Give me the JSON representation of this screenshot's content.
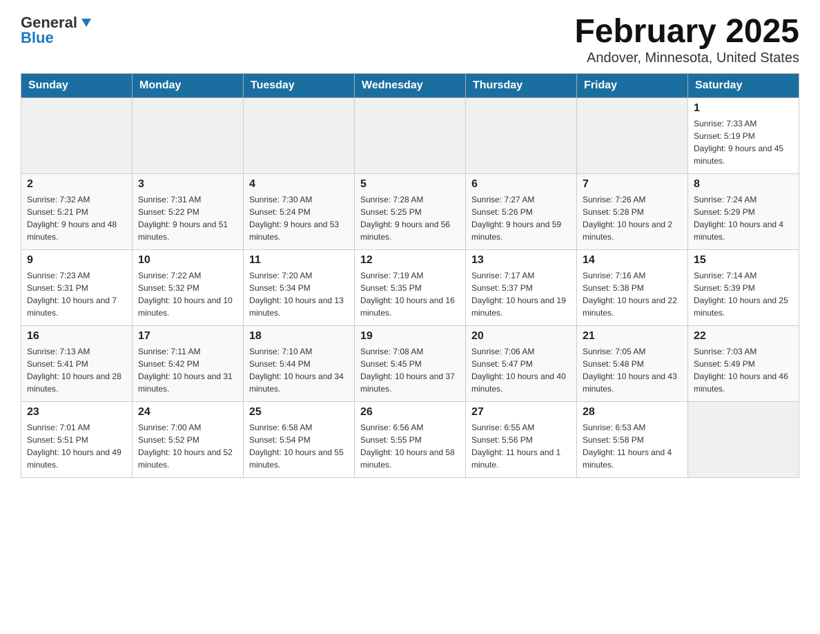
{
  "header": {
    "logo_general": "General",
    "logo_blue": "Blue",
    "title": "February 2025",
    "subtitle": "Andover, Minnesota, United States"
  },
  "days_of_week": [
    "Sunday",
    "Monday",
    "Tuesday",
    "Wednesday",
    "Thursday",
    "Friday",
    "Saturday"
  ],
  "weeks": [
    [
      {
        "day": "",
        "info": ""
      },
      {
        "day": "",
        "info": ""
      },
      {
        "day": "",
        "info": ""
      },
      {
        "day": "",
        "info": ""
      },
      {
        "day": "",
        "info": ""
      },
      {
        "day": "",
        "info": ""
      },
      {
        "day": "1",
        "info": "Sunrise: 7:33 AM\nSunset: 5:19 PM\nDaylight: 9 hours and 45 minutes."
      }
    ],
    [
      {
        "day": "2",
        "info": "Sunrise: 7:32 AM\nSunset: 5:21 PM\nDaylight: 9 hours and 48 minutes."
      },
      {
        "day": "3",
        "info": "Sunrise: 7:31 AM\nSunset: 5:22 PM\nDaylight: 9 hours and 51 minutes."
      },
      {
        "day": "4",
        "info": "Sunrise: 7:30 AM\nSunset: 5:24 PM\nDaylight: 9 hours and 53 minutes."
      },
      {
        "day": "5",
        "info": "Sunrise: 7:28 AM\nSunset: 5:25 PM\nDaylight: 9 hours and 56 minutes."
      },
      {
        "day": "6",
        "info": "Sunrise: 7:27 AM\nSunset: 5:26 PM\nDaylight: 9 hours and 59 minutes."
      },
      {
        "day": "7",
        "info": "Sunrise: 7:26 AM\nSunset: 5:28 PM\nDaylight: 10 hours and 2 minutes."
      },
      {
        "day": "8",
        "info": "Sunrise: 7:24 AM\nSunset: 5:29 PM\nDaylight: 10 hours and 4 minutes."
      }
    ],
    [
      {
        "day": "9",
        "info": "Sunrise: 7:23 AM\nSunset: 5:31 PM\nDaylight: 10 hours and 7 minutes."
      },
      {
        "day": "10",
        "info": "Sunrise: 7:22 AM\nSunset: 5:32 PM\nDaylight: 10 hours and 10 minutes."
      },
      {
        "day": "11",
        "info": "Sunrise: 7:20 AM\nSunset: 5:34 PM\nDaylight: 10 hours and 13 minutes."
      },
      {
        "day": "12",
        "info": "Sunrise: 7:19 AM\nSunset: 5:35 PM\nDaylight: 10 hours and 16 minutes."
      },
      {
        "day": "13",
        "info": "Sunrise: 7:17 AM\nSunset: 5:37 PM\nDaylight: 10 hours and 19 minutes."
      },
      {
        "day": "14",
        "info": "Sunrise: 7:16 AM\nSunset: 5:38 PM\nDaylight: 10 hours and 22 minutes."
      },
      {
        "day": "15",
        "info": "Sunrise: 7:14 AM\nSunset: 5:39 PM\nDaylight: 10 hours and 25 minutes."
      }
    ],
    [
      {
        "day": "16",
        "info": "Sunrise: 7:13 AM\nSunset: 5:41 PM\nDaylight: 10 hours and 28 minutes."
      },
      {
        "day": "17",
        "info": "Sunrise: 7:11 AM\nSunset: 5:42 PM\nDaylight: 10 hours and 31 minutes."
      },
      {
        "day": "18",
        "info": "Sunrise: 7:10 AM\nSunset: 5:44 PM\nDaylight: 10 hours and 34 minutes."
      },
      {
        "day": "19",
        "info": "Sunrise: 7:08 AM\nSunset: 5:45 PM\nDaylight: 10 hours and 37 minutes."
      },
      {
        "day": "20",
        "info": "Sunrise: 7:06 AM\nSunset: 5:47 PM\nDaylight: 10 hours and 40 minutes."
      },
      {
        "day": "21",
        "info": "Sunrise: 7:05 AM\nSunset: 5:48 PM\nDaylight: 10 hours and 43 minutes."
      },
      {
        "day": "22",
        "info": "Sunrise: 7:03 AM\nSunset: 5:49 PM\nDaylight: 10 hours and 46 minutes."
      }
    ],
    [
      {
        "day": "23",
        "info": "Sunrise: 7:01 AM\nSunset: 5:51 PM\nDaylight: 10 hours and 49 minutes."
      },
      {
        "day": "24",
        "info": "Sunrise: 7:00 AM\nSunset: 5:52 PM\nDaylight: 10 hours and 52 minutes."
      },
      {
        "day": "25",
        "info": "Sunrise: 6:58 AM\nSunset: 5:54 PM\nDaylight: 10 hours and 55 minutes."
      },
      {
        "day": "26",
        "info": "Sunrise: 6:56 AM\nSunset: 5:55 PM\nDaylight: 10 hours and 58 minutes."
      },
      {
        "day": "27",
        "info": "Sunrise: 6:55 AM\nSunset: 5:56 PM\nDaylight: 11 hours and 1 minute."
      },
      {
        "day": "28",
        "info": "Sunrise: 6:53 AM\nSunset: 5:58 PM\nDaylight: 11 hours and 4 minutes."
      },
      {
        "day": "",
        "info": ""
      }
    ]
  ]
}
